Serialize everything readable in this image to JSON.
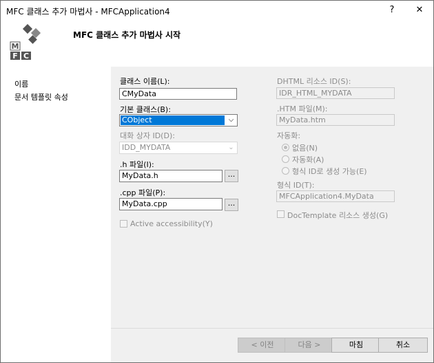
{
  "window": {
    "title": "MFC 클래스 추가 마법사 - MFCApplication4",
    "help_glyph": "?",
    "close_glyph": "✕"
  },
  "header": {
    "title": "MFC 클래스 추가 마법사 시작",
    "logo_letters": [
      "M",
      "F",
      "C"
    ]
  },
  "sidebar": {
    "items": [
      {
        "label": "이름"
      },
      {
        "label": "문서 템플릿 속성"
      }
    ]
  },
  "form": {
    "class_name": {
      "label": "클래스 이름(L):",
      "value": "CMyData"
    },
    "base_class": {
      "label": "기본 클래스(B):",
      "value": "CObject"
    },
    "dialog_id": {
      "label": "대화 상자 ID(D):",
      "value": "IDD_MYDATA"
    },
    "h_file": {
      "label": ".h 파일(I):",
      "value": "MyData.h",
      "browse": "..."
    },
    "cpp_file": {
      "label": ".cpp 파일(P):",
      "value": "MyData.cpp",
      "browse": "..."
    },
    "active_accessibility": {
      "label": "Active accessibility(Y)",
      "checked": false
    },
    "dhtml_id": {
      "label": "DHTML 리소스 ID(S):",
      "value": "IDR_HTML_MYDATA"
    },
    "htm_file": {
      "label": ".HTM 파일(M):",
      "value": "MyData.htm"
    },
    "automation": {
      "label": "자동화:",
      "options": [
        {
          "label": "없음(N)",
          "selected": true
        },
        {
          "label": "자동화(A)",
          "selected": false
        },
        {
          "label": "형식 ID로 생성 가능(E)",
          "selected": false
        }
      ]
    },
    "type_id": {
      "label": "형식 ID(T):",
      "value": "MFCApplication4.MyData"
    },
    "doctemplate": {
      "label": "DocTemplate 리소스 생성(G)",
      "checked": false
    }
  },
  "buttons": {
    "prev": "< 이전",
    "next": "다음 >",
    "finish": "마침",
    "cancel": "취소"
  }
}
